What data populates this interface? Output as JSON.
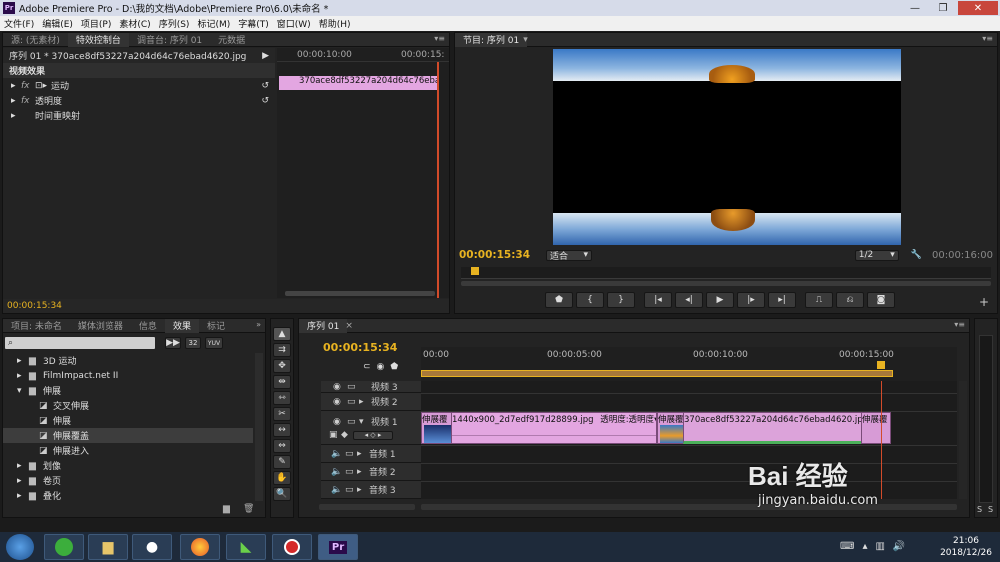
{
  "window": {
    "title": "Adobe Premiere Pro - D:\\我的文档\\Adobe\\Premiere Pro\\6.0\\未命名 *",
    "app_badge": "Pr"
  },
  "menu": [
    "文件(F)",
    "编辑(E)",
    "项目(P)",
    "素材(C)",
    "序列(S)",
    "标记(M)",
    "字幕(T)",
    "窗口(W)",
    "帮助(H)"
  ],
  "source_panel": {
    "tabs": [
      "源: (无素材)",
      "特效控制台",
      "调音台: 序列 01",
      "元数据"
    ],
    "active_tab": 1,
    "sequence_label": "序列 01 * 370ace8df53227a204d64c76ebad4620.jpg",
    "ruler_time": "00:00:10:00",
    "ruler_time_end": "00:00:15:",
    "clip_name": "370ace8df53227a204d64c76ebad",
    "section": "视频效果",
    "effects": [
      "运动",
      "透明度",
      "时间重映射"
    ],
    "fx_badge": "fx",
    "timecode": "00:00:15:34"
  },
  "program_monitor": {
    "tab": "节目: 序列 01",
    "timecode": "00:00:15:34",
    "fit": "适合",
    "resolution": "1/2",
    "duration": "00:00:16:00",
    "buttons": [
      "marker-button",
      "mark-in-button",
      "mark-out-button",
      "go-to-in-button",
      "step-back-button",
      "play-button",
      "step-forward-button",
      "go-to-out-button",
      "lift-button",
      "extract-button",
      "export-frame-button"
    ],
    "button_glyphs": [
      "⬟",
      "{",
      "}",
      "|◂",
      "◂|",
      "▶",
      "|▸",
      "▸|",
      "⎍",
      "⎌",
      "◙"
    ],
    "add_glyph": "+"
  },
  "project_panel": {
    "tabs": [
      "项目: 未命名",
      "媒体浏览器",
      "信息",
      "效果",
      "标记"
    ],
    "active_tab": 3,
    "badges": [
      "32",
      "YUV"
    ],
    "tree": [
      {
        "label": "3D 运动",
        "type": "folder",
        "level": 1
      },
      {
        "label": "FilmImpact.net II",
        "type": "folder",
        "level": 1
      },
      {
        "label": "伸展",
        "type": "folder-open",
        "level": 1
      },
      {
        "label": "交叉伸展",
        "type": "effect",
        "level": 2
      },
      {
        "label": "伸展",
        "type": "effect",
        "level": 2
      },
      {
        "label": "伸展覆盖",
        "type": "effect",
        "level": 2,
        "selected": true
      },
      {
        "label": "伸展进入",
        "type": "effect",
        "level": 2
      },
      {
        "label": "划像",
        "type": "folder",
        "level": 1
      },
      {
        "label": "卷页",
        "type": "folder",
        "level": 1
      },
      {
        "label": "叠化",
        "type": "folder",
        "level": 1
      }
    ]
  },
  "tools": [
    "selection-tool",
    "track-select-tool",
    "ripple-edit-tool",
    "rolling-edit-tool",
    "rate-stretch-tool",
    "razor-tool",
    "slip-tool",
    "slide-tool",
    "pen-tool",
    "hand-tool",
    "zoom-tool"
  ],
  "tool_glyphs": [
    "▲",
    "⇉",
    "✥",
    "⇹",
    "⇿",
    "✂",
    "↔",
    "⇔",
    "✎",
    "✋",
    "🔍"
  ],
  "timeline": {
    "tab": "序列 01",
    "timecode": "00:00:15:34",
    "ruler": [
      "00:00",
      "00:00:05:00",
      "00:00:10:00",
      "00:00:15:00"
    ],
    "tracks": [
      {
        "name": "视频 3",
        "kind": "video"
      },
      {
        "name": "视频 2",
        "kind": "video"
      },
      {
        "name": "视频 1",
        "kind": "video"
      },
      {
        "name": "音频 1",
        "kind": "audio"
      },
      {
        "name": "音频 2",
        "kind": "audio"
      },
      {
        "name": "音频 3",
        "kind": "audio"
      }
    ],
    "clips": {
      "transition1": "伸展覆",
      "clip1": "1440x900_2d7edf917d28899.jpg",
      "clip1_effect": "透明度:透明度",
      "transition2": "伸展覆",
      "clip2": "370ace8df53227a204d64c76ebad4620.jpg",
      "clip2_effect": "透",
      "transition3": "伸展覆"
    },
    "side_labels": [
      "S",
      "S"
    ]
  },
  "taskbar": {
    "time": "21:06",
    "date": "2018/12/26",
    "apps": [
      "start-button",
      "taskbar-app-green",
      "taskbar-app-explorer",
      "taskbar-app-qq",
      "taskbar-app-firefox",
      "taskbar-app-camtasia",
      "taskbar-app-recorder",
      "taskbar-app-premiere"
    ]
  },
  "watermark": {
    "brand": "Bai 经验",
    "url": "jingyan.baidu.com"
  },
  "colors": {
    "accent_timecode": "#e8b321",
    "clip_pink": "#e3a6e1",
    "playhead": "#d24b2a"
  }
}
